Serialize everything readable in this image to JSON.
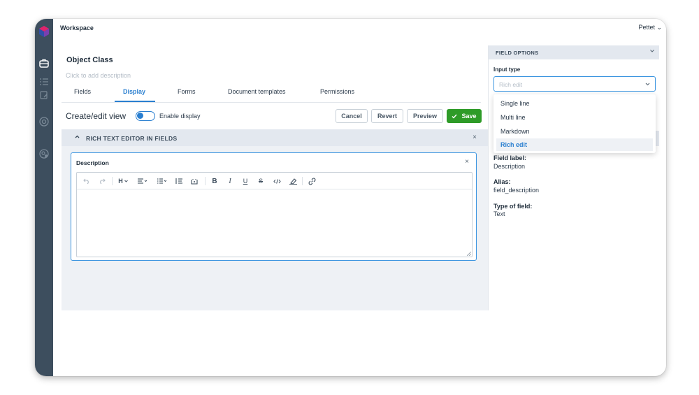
{
  "topbar": {
    "workspace": "Workspace",
    "user": "Pettet ⌄"
  },
  "object": {
    "title": "Object Class",
    "description_placeholder": "Click to add description"
  },
  "tabs": [
    {
      "label": "Fields"
    },
    {
      "label": "Display"
    },
    {
      "label": "Forms"
    },
    {
      "label": "Document templates"
    },
    {
      "label": "Permissions"
    }
  ],
  "view": {
    "title": "Create/edit view",
    "toggle_label": "Enable display",
    "toggle_on": true
  },
  "buttons": {
    "cancel": "Cancel",
    "revert": "Revert",
    "preview": "Preview",
    "save": "Save"
  },
  "section": {
    "label": "RICH TEXT EDITOR IN FIELDS",
    "close": "×"
  },
  "field_card": {
    "title": "Description",
    "close": "×"
  },
  "toolbar": {
    "heading": "H"
  },
  "right_panel": {
    "header": "FIELD OPTIONS",
    "input_type_label": "Input type",
    "input_type_value": "Rich edit",
    "options": [
      "Single line",
      "Multi line",
      "Markdown",
      "Rich edit"
    ],
    "selected_option": "Rich edit",
    "details": [
      {
        "label": "Field label:",
        "value": "Description"
      },
      {
        "label": "Alias:",
        "value": "field_description"
      },
      {
        "label": "Type of field:",
        "value": "Text"
      }
    ]
  },
  "colors": {
    "accent": "#2a7fd0",
    "save": "#2e9b28",
    "sidebar": "#3d4e5e"
  }
}
